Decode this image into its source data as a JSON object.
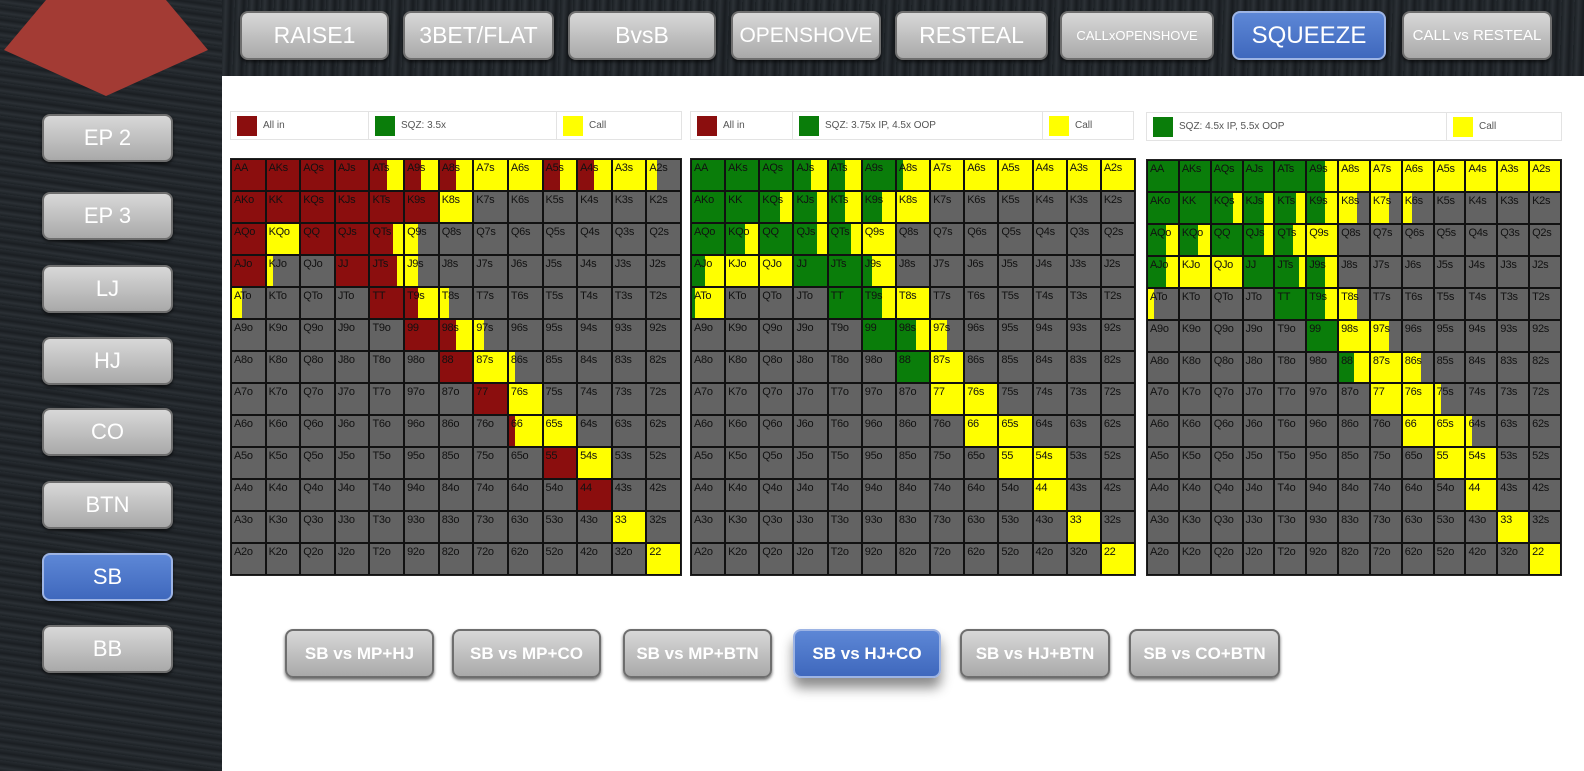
{
  "colors": {
    "allin": "#8b0e0e",
    "sqz": "#0a7d0a",
    "call": "#ffff00",
    "fold": "#636363",
    "active": "#4a72c9"
  },
  "top_tabs": [
    {
      "label": "RAISE1",
      "active": false
    },
    {
      "label": "3BET/FLAT",
      "active": false
    },
    {
      "label": "BvsB",
      "active": false
    },
    {
      "label": "OPENSHOVE",
      "active": false
    },
    {
      "label": "RESTEAL",
      "active": false
    },
    {
      "label": "CALLxOPENSHOVE",
      "active": false
    },
    {
      "label": "SQUEEZE",
      "active": true
    },
    {
      "label": "CALL vs RESTEAL",
      "active": false
    }
  ],
  "positions": [
    {
      "label": "EP 2",
      "active": false
    },
    {
      "label": "EP 3",
      "active": false
    },
    {
      "label": "LJ",
      "active": false
    },
    {
      "label": "HJ",
      "active": false
    },
    {
      "label": "CO",
      "active": false
    },
    {
      "label": "BTN",
      "active": false
    },
    {
      "label": "SB",
      "active": true
    },
    {
      "label": "BB",
      "active": false
    }
  ],
  "scenarios": [
    {
      "label": "SB vs MP+HJ",
      "active": false
    },
    {
      "label": "SB vs MP+CO",
      "active": false
    },
    {
      "label": "SB vs MP+BTN",
      "active": false
    },
    {
      "label": "SB vs HJ+CO",
      "active": true
    },
    {
      "label": "SB vs HJ+BTN",
      "active": false
    },
    {
      "label": "SB vs CO+BTN",
      "active": false
    }
  ],
  "charts": [
    {
      "legend": [
        {
          "color": "#8b0e0e",
          "label": "All in"
        },
        {
          "color": "#0a7d0a",
          "label": "SQZ: 3.5x"
        },
        {
          "color": "#ffff00",
          "label": "Call"
        }
      ]
    },
    {
      "legend": [
        {
          "color": "#8b0e0e",
          "label": "All in"
        },
        {
          "color": "#0a7d0a",
          "label": "SQZ: 3.75x IP, 4.5x OOP"
        },
        {
          "color": "#ffff00",
          "label": "Call"
        }
      ]
    },
    {
      "legend": [
        {
          "color": "#0a7d0a",
          "label": "SQZ: 4.5x IP, 5.5x OOP"
        },
        {
          "color": "#ffff00",
          "label": "Call"
        }
      ]
    }
  ],
  "hands": [
    [
      "AA",
      "AKs",
      "AQs",
      "AJs",
      "ATs",
      "A9s",
      "A8s",
      "A7s",
      "A6s",
      "A5s",
      "A4s",
      "A3s",
      "A2s"
    ],
    [
      "AKo",
      "KK",
      "KQs",
      "KJs",
      "KTs",
      "K9s",
      "K8s",
      "K7s",
      "K6s",
      "K5s",
      "K4s",
      "K3s",
      "K2s"
    ],
    [
      "AQo",
      "KQo",
      "QQ",
      "QJs",
      "QTs",
      "Q9s",
      "Q8s",
      "Q7s",
      "Q6s",
      "Q5s",
      "Q4s",
      "Q3s",
      "Q2s"
    ],
    [
      "AJo",
      "KJo",
      "QJo",
      "JJ",
      "JTs",
      "J9s",
      "J8s",
      "J7s",
      "J6s",
      "J5s",
      "J4s",
      "J3s",
      "J2s"
    ],
    [
      "ATo",
      "KTo",
      "QTo",
      "JTo",
      "TT",
      "T9s",
      "T8s",
      "T7s",
      "T6s",
      "T5s",
      "T4s",
      "T3s",
      "T2s"
    ],
    [
      "A9o",
      "K9o",
      "Q9o",
      "J9o",
      "T9o",
      "99",
      "98s",
      "97s",
      "96s",
      "95s",
      "94s",
      "93s",
      "92s"
    ],
    [
      "A8o",
      "K8o",
      "Q8o",
      "J8o",
      "T8o",
      "98o",
      "88",
      "87s",
      "86s",
      "85s",
      "84s",
      "83s",
      "82s"
    ],
    [
      "A7o",
      "K7o",
      "Q7o",
      "J7o",
      "T7o",
      "97o",
      "87o",
      "77",
      "76s",
      "75s",
      "74s",
      "73s",
      "72s"
    ],
    [
      "A6o",
      "K6o",
      "Q6o",
      "J6o",
      "T6o",
      "96o",
      "86o",
      "76o",
      "66",
      "65s",
      "64s",
      "63s",
      "62s"
    ],
    [
      "A5o",
      "K5o",
      "Q5o",
      "J5o",
      "T5o",
      "95o",
      "85o",
      "75o",
      "65o",
      "55",
      "54s",
      "53s",
      "52s"
    ],
    [
      "A4o",
      "K4o",
      "Q4o",
      "J4o",
      "T4o",
      "94o",
      "84o",
      "74o",
      "64o",
      "54o",
      "44",
      "43s",
      "42s"
    ],
    [
      "A3o",
      "K3o",
      "Q3o",
      "J3o",
      "T3o",
      "93o",
      "83o",
      "73o",
      "63o",
      "53o",
      "43o",
      "33",
      "32s"
    ],
    [
      "A2o",
      "K2o",
      "Q2o",
      "J2o",
      "T2o",
      "92o",
      "82o",
      "72o",
      "62o",
      "52o",
      "42o",
      "32o",
      "22"
    ]
  ],
  "strategies": [
    {
      "AA": "R",
      "AKs": "R",
      "AQs": "R",
      "AJs": "R",
      "ATs": "R.5Y",
      "A9s": "R.5Y",
      "A8s": "R.5Y",
      "A7s": "Y",
      "A6s": "Y",
      "A5s": "R.5Y",
      "A4s": "R.5Y",
      "A3s": "Y",
      "A2s": "Y.3",
      "AKo": "R",
      "KK": "R",
      "KQs": "R",
      "KJs": "R",
      "KTs": "R",
      "K9s": "R",
      "K8s": "Y",
      "AQo": "R",
      "KQo": "Y",
      "QQ": "R",
      "QJs": "R",
      "QTs": "R.7Y",
      "Q9s": "Y.4",
      "AJo": "R",
      "KJo": "Y.2",
      "JJ": "R",
      "JTs": "R.8Y",
      "J9s": "Y.4",
      "ATo": "Y.3",
      "TT": "R",
      "T9s": "R.4Y",
      "T8s": "Y.3",
      "99": "R",
      "98s": "R.5Y",
      "97s": "Y.3",
      "88": "R",
      "87s": "Y",
      "86s": "Y.2",
      "77": "R",
      "76s": "Y",
      "66": "R.2Y",
      "65s": "Y",
      "55": "R",
      "54s": "Y",
      "44": "R",
      "33": "Y",
      "22": "Y"
    },
    {
      "AA": "G",
      "AKs": "G",
      "AQs": "G",
      "AJs": "G.5Y",
      "ATs": "G.5Y",
      "A9s": "G",
      "A8s": "G.2Y",
      "A7s": "Y",
      "A6s": "Y",
      "A5s": "Y",
      "A4s": "Y",
      "A3s": "Y",
      "A2s": "Y",
      "AKo": "G",
      "KK": "G",
      "KQs": "G.6Y",
      "KJs": "G.7Y",
      "KTs": "G.5Y",
      "K9s": "G.6Y",
      "K8s": "Y",
      "AQo": "G",
      "KQo": "G.6Y",
      "QQ": "G",
      "QJs": "G.7Y",
      "QTs": "G.7Y",
      "Q9s": "Y",
      "AJo": "G.4Y",
      "KJo": "Y",
      "QJo": "Y",
      "JJ": "G",
      "JTs": "G",
      "J9s": "G.3Y",
      "ATo": "G.1Y",
      "TT": "G",
      "T9s": "G.6Y",
      "T8s": "Y",
      "99": "G",
      "98s": "G.6Y",
      "97s": "Y.5",
      "88": "G",
      "87s": "Y",
      "77": "Y",
      "76s": "Y",
      "66": "Y",
      "65s": "Y",
      "55": "Y",
      "54s": "Y",
      "44": "Y",
      "33": "Y",
      "22": "Y"
    },
    {
      "AA": "G",
      "AKs": "G",
      "AQs": "G",
      "AJs": "G",
      "ATs": "G",
      "A9s": "G.6Y",
      "A8s": "Y",
      "A7s": "Y",
      "A6s": "Y",
      "A5s": "Y",
      "A4s": "Y",
      "A3s": "Y",
      "A2s": "Y",
      "AKo": "G",
      "KK": "G",
      "KQs": "G.7Y",
      "KJs": "G.7Y",
      "KTs": "G.7Y",
      "K9s": "G.6Y",
      "K8s": "Y.6",
      "K7s": "Y.6",
      "K6s": "Y.3",
      "AQo": "G.6Y",
      "KQo": "G.6Y",
      "QQ": "G",
      "QJs": "G.7Y",
      "QTs": "G.6Y",
      "Q9s": "Y",
      "AJo": "G.6Y",
      "KJo": "Y",
      "QJo": "Y",
      "JJ": "G",
      "JTs": "G.8Y",
      "J9s": "G.6Y",
      "ATo": "Y.2",
      "TT": "G",
      "T9s": "G.6Y",
      "T8s": "Y.6",
      "99": "G",
      "98s": "Y",
      "97s": "Y.6",
      "88": "G.5Y",
      "87s": "Y",
      "86s": "Y.6",
      "77": "Y",
      "76s": "Y",
      "75s": "Y.2",
      "66": "Y",
      "65s": "Y",
      "64s": "Y.2",
      "55": "Y",
      "54s": "Y",
      "44": "Y",
      "33": "Y",
      "22": "Y"
    }
  ]
}
